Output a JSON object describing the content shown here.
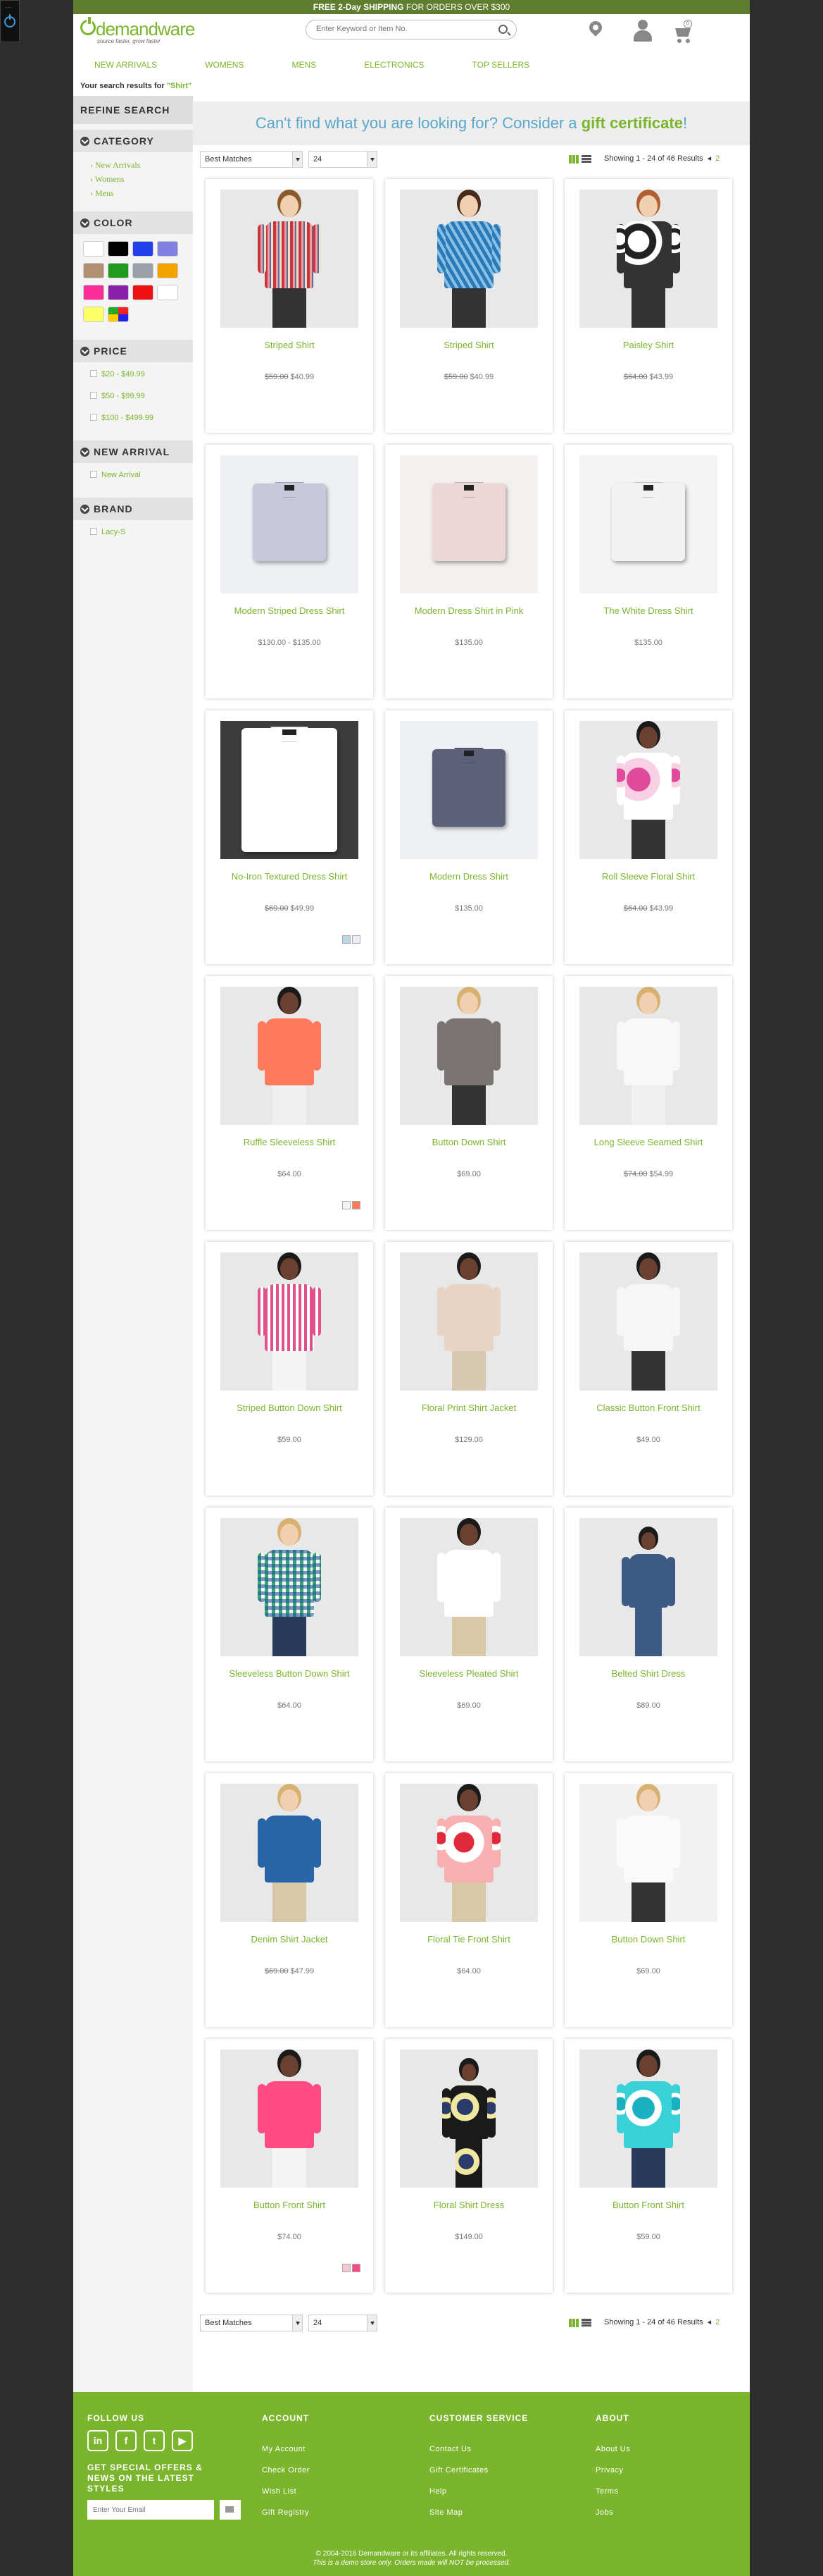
{
  "topbar": {
    "bold": "FREE 2-Day SHIPPING",
    "rest": " FOR ORDERS OVER $300"
  },
  "logo": {
    "name": "demandware",
    "tagline": "source faster, grow faster"
  },
  "search": {
    "placeholder": "Enter Keyword or Item No."
  },
  "cart": {
    "count": "0"
  },
  "nav": [
    "NEW ARRIVALS",
    "WOMENS",
    "MENS",
    "ELECTRONICS",
    "TOP SELLERS"
  ],
  "results": {
    "prefix": "Your search results for ",
    "term": "\"Shirt\""
  },
  "refine": {
    "title": "REFINE SEARCH",
    "category_title": "CATEGORY",
    "categories": [
      "New Arrivals",
      "Womens",
      "Mens"
    ],
    "color_title": "COLOR",
    "colors": [
      "#ffffff",
      "#000000",
      "#1f3fe8",
      "#8080e0",
      "#b09070",
      "#1f9a1f",
      "#9aa0a8",
      "#f5a200",
      "#ff2d9a",
      "#8a1fa8",
      "#ee1111",
      "#ffffff",
      "#ffff66",
      "multi"
    ],
    "price_title": "PRICE",
    "prices": [
      "$20 - $49.99",
      "$50 - $99.99",
      "$100 - $499.99"
    ],
    "arrival_title": "NEW ARRIVAL",
    "arrivals": [
      "New Arrival"
    ],
    "brand_title": "BRAND",
    "brands": [
      "Lacy-S"
    ]
  },
  "banner": {
    "text": "Can't find what you are looking for? Consider a ",
    "link": "gift certificate",
    "end": "!"
  },
  "toolbar": {
    "sort": "Best Matches",
    "per_page": "24",
    "showing": "Showing 1 - 24 of 46 Results",
    "page": "2"
  },
  "products": [
    {
      "name": "Striped Shirt",
      "old": "$59.00",
      "price": "$40.99",
      "kind": "woman",
      "skin": "#f0d0b0",
      "hair": "#8a5a2a",
      "shirt": "stripe-red",
      "pants": "#333",
      "bg": "#e8e8e8"
    },
    {
      "name": "Striped Shirt",
      "old": "$59.00",
      "price": "$40.99",
      "kind": "woman",
      "skin": "#f0d0b0",
      "hair": "#4a2a1a",
      "shirt": "stripe-blue",
      "pants": "#333",
      "bg": "#e8e8e8"
    },
    {
      "name": "Paisley Shirt",
      "old": "$64.00",
      "price": "$43.99",
      "kind": "woman",
      "skin": "#f0d0b0",
      "hair": "#b06030",
      "shirt": "paisley",
      "pants": "#333",
      "bg": "#e8e8e8"
    },
    {
      "name": "Modern Striped Dress Shirt",
      "old": "",
      "price": "$130.00 - $135.00",
      "kind": "folded",
      "shirt": "#c8c8dc",
      "bg": "#eef0f4"
    },
    {
      "name": "Modern Dress Shirt in Pink",
      "old": "",
      "price": "$135.00",
      "kind": "folded",
      "shirt": "#ecd6d6",
      "bg": "#f4f0f0"
    },
    {
      "name": "The White Dress Shirt",
      "old": "",
      "price": "$135.00",
      "kind": "folded",
      "shirt": "#f2f2f2",
      "bg": "#f4f4f4"
    },
    {
      "name": "No-Iron Textured Dress Shirt",
      "old": "$69.00",
      "price": "$49.99",
      "kind": "folded-big",
      "shirt": "#ffffff",
      "bg": "#3c3c3c",
      "swatches": [
        "#bcd6ea",
        "#e8eef4"
      ]
    },
    {
      "name": "Modern Dress Shirt",
      "old": "",
      "price": "$135.00",
      "kind": "folded",
      "shirt": "#5c6078",
      "bg": "#eef0f4"
    },
    {
      "name": "Roll Sleeve Floral Shirt",
      "old": "$64.00",
      "price": "$43.99",
      "kind": "woman",
      "skin": "#6a4030",
      "hair": "#1a1a1a",
      "shirt": "floral-pink",
      "pants": "#333",
      "bg": "#e8e8e8"
    },
    {
      "name": "Ruffle Sleeveless Shirt",
      "old": "",
      "price": "$64.00",
      "kind": "woman",
      "skin": "#6a4030",
      "hair": "#1a1a1a",
      "shirt": "#ff7a5a",
      "pants": "#f0f0f0",
      "bg": "#e8e8e8",
      "swatches": [
        "#f4f4f4",
        "#ff7a5a"
      ]
    },
    {
      "name": "Button Down Shirt",
      "old": "",
      "price": "$69.00",
      "kind": "woman",
      "skin": "#f0d0b0",
      "hair": "#d8b070",
      "shirt": "#7a7472",
      "pants": "#333",
      "bg": "#e8e8e8"
    },
    {
      "name": "Long Sleeve Seamed Shirt",
      "old": "$74.00",
      "price": "$54.99",
      "kind": "woman",
      "skin": "#f0d0b0",
      "hair": "#d8b070",
      "shirt": "#f8f8f8",
      "pants": "#f0f0f0",
      "bg": "#e8e8e8"
    },
    {
      "name": "Striped Button Down Shirt",
      "old": "",
      "price": "$59.00",
      "kind": "woman",
      "skin": "#6a4030",
      "hair": "#1a1a1a",
      "shirt": "stripe-pink",
      "pants": "#f4f4f4",
      "bg": "#e8e8e8"
    },
    {
      "name": "Floral Print Shirt Jacket",
      "old": "",
      "price": "$129.00",
      "kind": "woman",
      "skin": "#6a4030",
      "hair": "#1a1a1a",
      "shirt": "#e8d4c4",
      "pants": "#d8c8b0",
      "bg": "#e8e8e8"
    },
    {
      "name": "Classic Button Front Shirt",
      "old": "",
      "price": "$49.00",
      "kind": "woman",
      "skin": "#6a4030",
      "hair": "#1a1a1a",
      "shirt": "#f6f6f6",
      "pants": "#333",
      "bg": "#e8e8e8"
    },
    {
      "name": "Sleeveless Button Down Shirt",
      "old": "",
      "price": "$64.00",
      "kind": "woman",
      "skin": "#f0d0b0",
      "hair": "#d8b070",
      "shirt": "plaid",
      "pants": "#2a3a5a",
      "bg": "#e8e8e8"
    },
    {
      "name": "Sleeveless Pleated Shirt",
      "old": "",
      "price": "$69.00",
      "kind": "woman",
      "skin": "#6a4030",
      "hair": "#1a1a1a",
      "shirt": "#ffffff",
      "pants": "#d8c8a8",
      "bg": "#e8e8e8"
    },
    {
      "name": "Belted Shirt Dress",
      "old": "",
      "price": "$89.00",
      "kind": "woman-small",
      "skin": "#6a4030",
      "hair": "#1a1a1a",
      "shirt": "#3c5a84",
      "pants": "#3c5a84",
      "bg": "#e8e8e8"
    },
    {
      "name": "Denim Shirt Jacket",
      "old": "$69.00",
      "price": "$47.99",
      "kind": "woman",
      "skin": "#f0d0b0",
      "hair": "#d8b070",
      "shirt": "#2a64a8",
      "pants": "#d8c8a8",
      "bg": "#e8e8e8"
    },
    {
      "name": "Floral Tie Front Shirt",
      "old": "",
      "price": "$64.00",
      "kind": "woman",
      "skin": "#6a4030",
      "hair": "#1a1a1a",
      "shirt": "floral-red",
      "pants": "#d8c8a8",
      "bg": "#e8e8e8"
    },
    {
      "name": "Button Down Shirt",
      "old": "",
      "price": "$69.00",
      "kind": "woman",
      "skin": "#f0d0b0",
      "hair": "#d8b070",
      "shirt": "#fafafa",
      "pants": "#333",
      "bg": "#f2f2f2"
    },
    {
      "name": "Button Front Shirt",
      "old": "",
      "price": "$74.00",
      "kind": "woman",
      "skin": "#6a4030",
      "hair": "#1a1a1a",
      "shirt": "#ff4a84",
      "pants": "#f4f4f4",
      "bg": "#e8e8e8",
      "swatches": [
        "#f4c8d0",
        "#ff4a84"
      ]
    },
    {
      "name": "Floral Shirt Dress",
      "old": "",
      "price": "$149.00",
      "kind": "woman-small",
      "skin": "#6a4030",
      "hair": "#1a1a1a",
      "shirt": "floral-dark",
      "pants": "floral-dark",
      "bg": "#e8e8e8"
    },
    {
      "name": "Button Front Shirt",
      "old": "",
      "price": "$59.00",
      "kind": "woman",
      "skin": "#6a4030",
      "hair": "#1a1a1a",
      "shirt": "floral-teal",
      "pants": "#2a3a5a",
      "bg": "#e8e8e8"
    }
  ],
  "footer": {
    "follow_title": "FOLLOW US",
    "social": [
      "in",
      "f",
      "t",
      "yt"
    ],
    "offer": "GET SPECIAL OFFERS & NEWS ON THE LATEST STYLES",
    "email_placeholder": "Enter Your Email",
    "account_title": "ACCOUNT",
    "account_links": [
      "My Account",
      "Check Order",
      "Wish List",
      "Gift Registry"
    ],
    "service_title": "CUSTOMER SERVICE",
    "service_links": [
      "Contact Us",
      "Gift Certificates",
      "Help",
      "Site Map"
    ],
    "about_title": "ABOUT",
    "about_links": [
      "About Us",
      "Privacy",
      "Terms",
      "Jobs"
    ],
    "copyright": "© 2004-2016 Demandware or its affiliates. All rights reserved.",
    "demo": "This is a demo store only. Orders made will NOT be processed."
  }
}
